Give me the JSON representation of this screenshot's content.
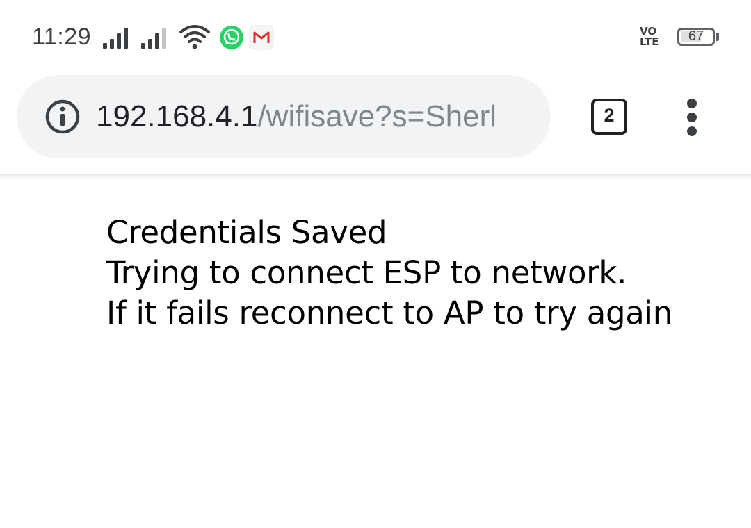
{
  "status_bar": {
    "time": "11:29",
    "network_label_line1": "VO",
    "network_label_line2": "LTE",
    "battery_level": "67",
    "battery_fraction": 0.67,
    "icons": [
      "signal-icon",
      "signal-icon",
      "wifi-icon",
      "whatsapp-icon",
      "gmail-icon"
    ],
    "colors": {
      "whatsapp": "#25d366",
      "gmail_red": "#d93025"
    }
  },
  "browser": {
    "url_host": "192.168.4.1",
    "url_path": "/wifisave?s=Sherl",
    "tab_count": "2",
    "colors": {
      "omnibox_bg": "#f1f3f4",
      "url_path": "#80868b"
    }
  },
  "page": {
    "lines": [
      "Credentials Saved",
      "Trying to connect ESP to network.",
      "If it fails reconnect to AP to try again"
    ]
  }
}
